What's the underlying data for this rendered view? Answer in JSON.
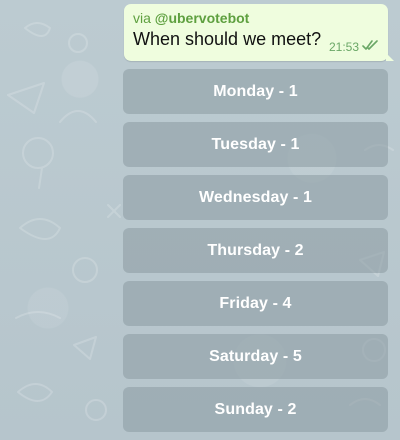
{
  "message": {
    "via_prefix": "via ",
    "bot_name": "@ubervotebot",
    "text": "When should we meet?",
    "time": "21:53",
    "status_icon": "double-check-icon"
  },
  "vote_buttons": [
    {
      "label": "Monday - 1"
    },
    {
      "label": "Tuesday - 1"
    },
    {
      "label": "Wednesday - 1"
    },
    {
      "label": "Thursday - 2"
    },
    {
      "label": "Friday - 4"
    },
    {
      "label": "Saturday - 5"
    },
    {
      "label": "Sunday - 2"
    }
  ],
  "colors": {
    "chat_background": "#b9c8cf",
    "message_bubble": "#effdde",
    "bot_link": "#5ea03f",
    "button_background": "#8e9da4"
  }
}
